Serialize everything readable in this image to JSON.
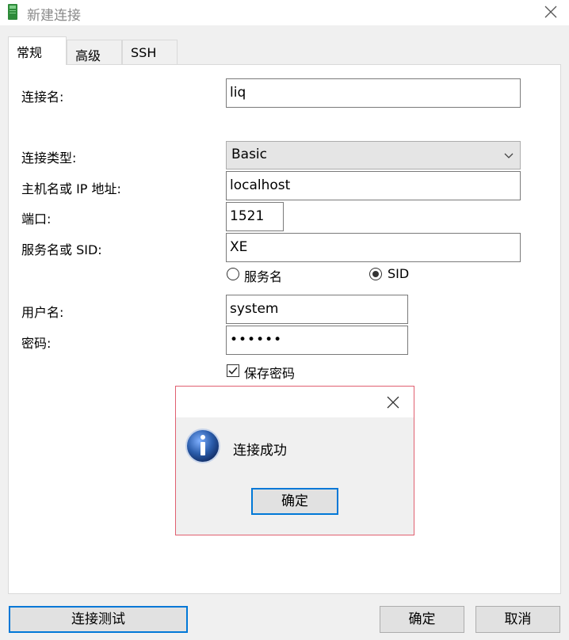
{
  "window": {
    "title": "新建连接"
  },
  "tabs": [
    "常规",
    "高级",
    "SSH"
  ],
  "form": {
    "conn_name_label": "连接名:",
    "conn_name_value": "liq",
    "conn_type_label": "连接类型:",
    "conn_type_value": "Basic",
    "host_label": "主机名或 IP 地址:",
    "host_value": "localhost",
    "port_label": "端口:",
    "port_value": "1521",
    "service_label": "服务名或 SID:",
    "service_value": "XE",
    "radio_service_name": "服务名",
    "radio_sid": "SID",
    "radio_selected": "SID",
    "user_label": "用户名:",
    "user_value": "system",
    "password_label": "密码:",
    "password_value": "••••••",
    "save_password_label": "保存密码",
    "save_password_checked": true
  },
  "buttons": {
    "test": "连接测试",
    "ok": "确定",
    "cancel": "取消"
  },
  "dialog": {
    "message": "连接成功",
    "ok": "确定"
  },
  "colors": {
    "accent": "#0078d7",
    "dialog_border": "#e06070",
    "icon_blue": "#2a5caa"
  }
}
